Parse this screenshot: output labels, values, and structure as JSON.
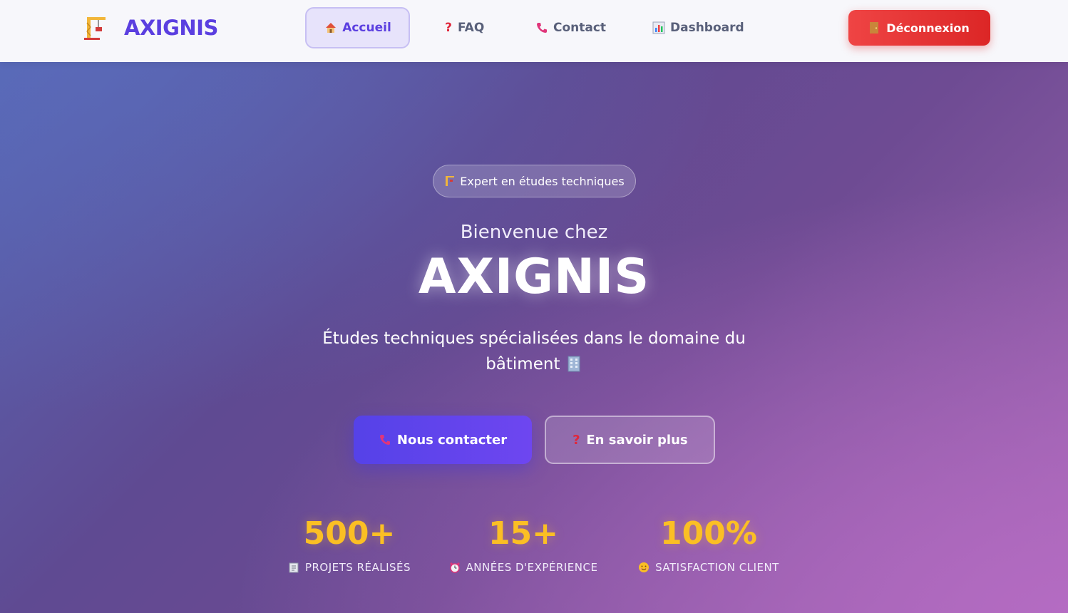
{
  "brand": {
    "name": "AXIGNIS",
    "icon": "construction-crane-icon"
  },
  "nav": {
    "items": [
      {
        "label": "Accueil",
        "icon": "house-icon",
        "active": true
      },
      {
        "label": "FAQ",
        "icon": "question-mark-icon",
        "active": false
      },
      {
        "label": "Contact",
        "icon": "phone-icon",
        "active": false
      },
      {
        "label": "Dashboard",
        "icon": "bar-chart-icon",
        "active": false
      }
    ],
    "logout_label": "Déconnexion",
    "logout_icon": "door-icon"
  },
  "hero": {
    "badge": "Expert en études techniques",
    "welcome": "Bienvenue chez",
    "title": "AXIGNIS",
    "subtitle": "Études techniques spécialisées dans le domaine du bâtiment",
    "primary_button": "Nous contacter",
    "secondary_button": "En savoir plus"
  },
  "stats": [
    {
      "value": "500+",
      "label": "PROJETS RÉALISÉS",
      "icon": "clipboard-icon"
    },
    {
      "value": "15+",
      "label": "ANNÉES D'EXPÉRIENCE",
      "icon": "alarm-clock-icon"
    },
    {
      "value": "100%",
      "label": "SATISFACTION CLIENT",
      "icon": "smiling-face-icon"
    }
  ],
  "colors": {
    "accent": "#5b3fe0",
    "logout": "#dc2626",
    "stat_value": "#fbbf24",
    "nav_active_bg": "#e7e3fb"
  }
}
